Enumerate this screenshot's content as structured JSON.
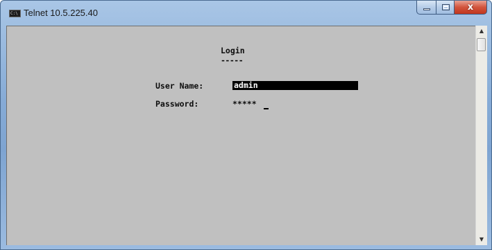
{
  "window": {
    "title": "Telnet 10.5.225.40",
    "app_icon_text": "C:\\",
    "controls": {
      "minimize_icon": "minimize-icon",
      "maximize_icon": "maximize-icon",
      "close_icon": "close-icon",
      "close_glyph": "x"
    }
  },
  "terminal": {
    "heading": "Login",
    "heading_underline": "-----",
    "username_label": "User Name:",
    "username_value": "admin",
    "password_label": "Password:",
    "password_value": "*****"
  },
  "scrollbar": {
    "up_glyph": "▲",
    "down_glyph": "▼"
  },
  "colors": {
    "terminal_background": "#c0c0c0",
    "terminal_text": "#0d0d0d",
    "highlight_background": "#000000",
    "highlight_text": "#ffffff",
    "close_button": "#c8432a",
    "title_bar": "#86abd6"
  }
}
